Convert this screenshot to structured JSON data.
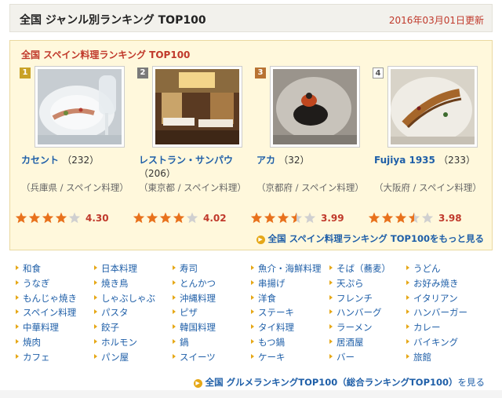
{
  "header": {
    "title": "全国 ジャンル別ランキング TOP100",
    "date": "2016年03月01日更新"
  },
  "ranking": {
    "title": "全国 スペイン料理ランキング TOP100",
    "more_link": "全国 スペイン料理ランキング TOP100をもっと見る",
    "items": [
      {
        "rank": "1",
        "name": "カセント",
        "count": "（232）",
        "area": "（兵庫県 / スペイン料理）",
        "score": "4.30",
        "stars": 4.0,
        "badge_color": "#c9a227",
        "photo": "plate-fish-wine"
      },
      {
        "rank": "2",
        "name": "レストラン・サンパウ",
        "count": "（206）",
        "area": "（東京都 / スペイン料理）",
        "score": "4.02",
        "stars": 4.0,
        "badge_color": "#7a7a7a",
        "photo": "dining-room"
      },
      {
        "rank": "3",
        "name": "アカ",
        "count": "（32）",
        "area": "（京都府 / スペイン料理）",
        "score": "3.99",
        "stars": 3.5,
        "badge_color": "#b87333",
        "photo": "dark-dish"
      },
      {
        "rank": "4",
        "name": "Fujiya 1935",
        "count": "（233）",
        "area": "（大阪府 / スペイン料理）",
        "score": "3.98",
        "stars": 3.5,
        "badge_color": "#ffffff",
        "photo": "fish-plate"
      }
    ]
  },
  "genres": [
    [
      "和食",
      "日本料理",
      "寿司",
      "魚介・海鮮料理",
      "そば（蕎麦）",
      "うどん"
    ],
    [
      "うなぎ",
      "焼き鳥",
      "とんかつ",
      "串揚げ",
      "天ぷら",
      "お好み焼き"
    ],
    [
      "もんじゃ焼き",
      "しゃぶしゃぶ",
      "沖縄料理",
      "洋食",
      "フレンチ",
      "イタリアン"
    ],
    [
      "スペイン料理",
      "パスタ",
      "ピザ",
      "ステーキ",
      "ハンバーグ",
      "ハンバーガー"
    ],
    [
      "中華料理",
      "餃子",
      "韓国料理",
      "タイ料理",
      "ラーメン",
      "カレー"
    ],
    [
      "焼肉",
      "ホルモン",
      "鍋",
      "もつ鍋",
      "居酒屋",
      "バイキング"
    ],
    [
      "カフェ",
      "パン屋",
      "スイーツ",
      "ケーキ",
      "バー",
      "旅館"
    ]
  ],
  "bottom_link": {
    "bold": "全国 グルメランキングTOP100（総合ランキングTOP100）",
    "tail": "を見る"
  },
  "colors": {
    "link": "#1f5fa8",
    "accent": "#c0392b",
    "star_on": "#e8711c",
    "star_off": "#d0d0d0"
  }
}
